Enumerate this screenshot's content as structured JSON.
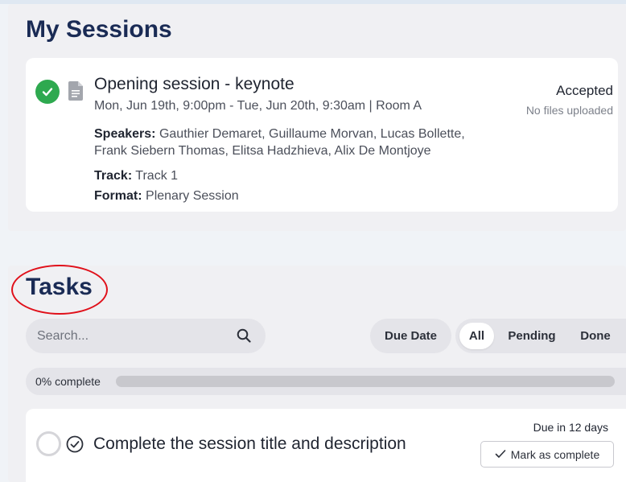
{
  "sessions": {
    "heading": "My Sessions",
    "items": [
      {
        "title": "Opening session - keynote",
        "datetime": "Mon, Jun 19th, 9:00pm - Tue, Jun 20th, 9:30am | Room A",
        "speakers_label": "Speakers:",
        "speakers": "Gauthier Demaret, Guillaume Morvan, Lucas Bollette, Frank Siebern Thomas, Elitsa Hadzhieva, Alix De Montjoye",
        "track_label": "Track:",
        "track": "Track 1",
        "format_label": "Format:",
        "format": "Plenary Session",
        "status": "Accepted",
        "files_status": "No files uploaded",
        "status_icon": "check-circle-icon",
        "type_icon": "document-icon"
      }
    ]
  },
  "tasks": {
    "heading": "Tasks",
    "search": {
      "placeholder": "Search...",
      "value": ""
    },
    "sort_label": "Due Date",
    "filters": [
      {
        "label": "All",
        "active": true
      },
      {
        "label": "Pending",
        "active": false
      },
      {
        "label": "Done",
        "active": false
      }
    ],
    "progress": {
      "label": "0% complete",
      "fraction": 0
    },
    "items": [
      {
        "title": "Complete the session title and description",
        "due": "Due in 12 days",
        "action_label": "Mark as complete"
      }
    ]
  },
  "colors": {
    "accent_green": "#2ea94f",
    "heading_navy": "#1a2b55",
    "highlight_red": "#e0101a"
  }
}
